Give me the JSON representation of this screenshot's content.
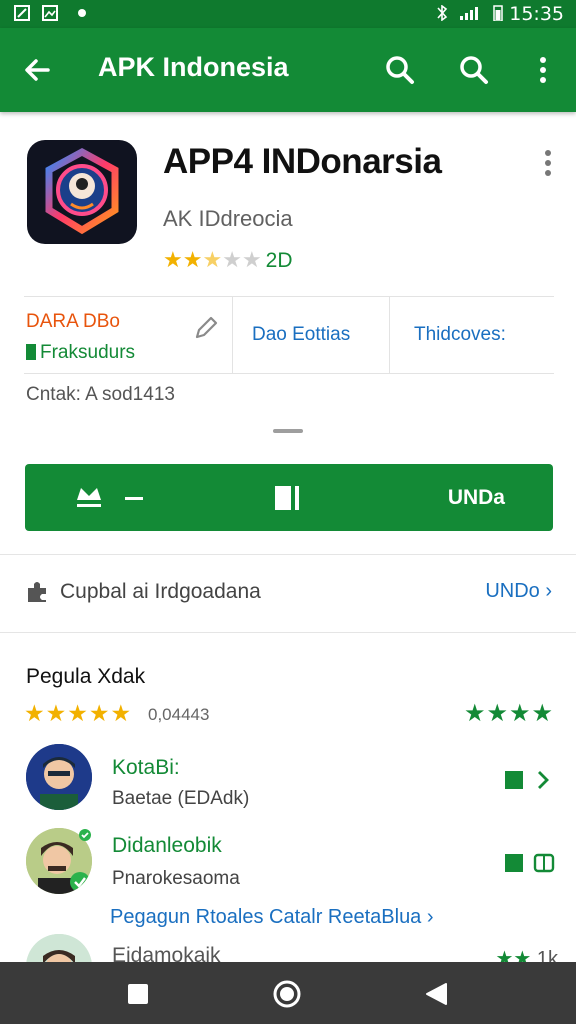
{
  "status_bar": {
    "time": "15:35"
  },
  "app_bar": {
    "title": "APK Indonesia"
  },
  "app": {
    "title": "APP4 INDonarsia",
    "developer": "AK IDdreocia",
    "rating_count": "2D",
    "rating": 2.5
  },
  "info": {
    "label_orange": "DARA DBo",
    "label_green": "Fraksudurs",
    "tab1": "Dao Eottias",
    "tab2": "Thidcoves:",
    "contact": "Cntak: A sod1413"
  },
  "install": {
    "label": "UNDa"
  },
  "category": {
    "text": "Cupbal ai Irdgoadana",
    "link": "UNDo"
  },
  "reviews": {
    "heading": "Pegula Xdak",
    "count": "0,04443",
    "items": [
      {
        "name": "KotaBi:",
        "sub": "Baetae (EDAdk)"
      },
      {
        "name": "Didanleobik",
        "sub": "Pnarokesaoma"
      }
    ],
    "link": "Pegagun Rtoales Catalr ReetaBlua",
    "partial_name": "Eidamokaik",
    "partial_count": "1k"
  },
  "colors": {
    "primary": "#138a36",
    "status": "#0f7a2e",
    "link": "#1a6fc0",
    "orange": "#e8540c",
    "star": "#f2b100"
  }
}
